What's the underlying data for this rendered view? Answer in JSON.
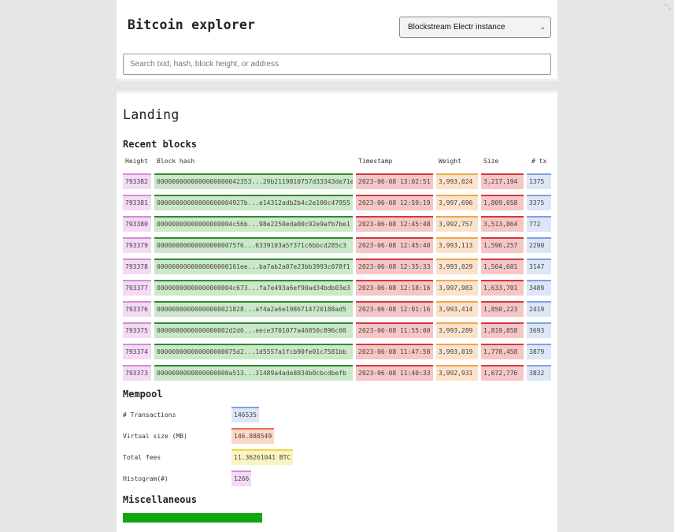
{
  "app": {
    "title": "Bitcoin explorer",
    "instance_selected": "Blockstream Electr instance",
    "search_placeholder": "Search txid, hash, block height, or address"
  },
  "page": {
    "title": "Landing"
  },
  "recent_blocks": {
    "title": "Recent blocks",
    "columns": [
      "Height",
      "Block hash",
      "Timestamp",
      "Weight",
      "Size",
      "# tx"
    ],
    "rows": [
      {
        "height": "793382",
        "hash": "0000000000000000000042353...29b2119810757d33343de71e",
        "timestamp": "2023-06-08 13:02:51",
        "weight": "3,993,024",
        "size": "3,217,194",
        "tx": "1375"
      },
      {
        "height": "793381",
        "hash": "00000000000000000004927b...e14312adb2b4c2e100c47955",
        "timestamp": "2023-06-08 12:59:19",
        "weight": "3,997,696",
        "size": "1,809,058",
        "tx": "3375"
      },
      {
        "height": "793380",
        "hash": "00000000000000000004c56b...98e2250eda00c92e9afb7be1",
        "timestamp": "2023-06-08 12:45:48",
        "weight": "3,992,757",
        "size": "3,513,864",
        "tx": "772"
      },
      {
        "height": "793379",
        "hash": "00000000000000000007576...6339103a5f371c6bbcd285c3",
        "timestamp": "2023-06-08 12:45:40",
        "weight": "3,993,113",
        "size": "1,596,257",
        "tx": "2290"
      },
      {
        "height": "793378",
        "hash": "0000000000000000000161ee...ba7ab2a07e23bb3993c078f1",
        "timestamp": "2023-06-08 12:35:33",
        "weight": "3,993,029",
        "size": "1,564,601",
        "tx": "3147"
      },
      {
        "height": "793377",
        "hash": "00000000000000000004c673...fa7e493a6ef90ad34bdb03e3",
        "timestamp": "2023-06-08 12:18:16",
        "weight": "3,997,983",
        "size": "1,633,701",
        "tx": "3489"
      },
      {
        "height": "793376",
        "hash": "00000000000000000021828...af4a2a6e1986714720188ad5",
        "timestamp": "2023-06-08 12:01:16",
        "weight": "3,993,414",
        "size": "1,850,223",
        "tx": "2419"
      },
      {
        "height": "793375",
        "hash": "0000000000000000002d2d6...eece3701077a46050c896c00",
        "timestamp": "2023-06-08 11:55:00",
        "weight": "3,993,289",
        "size": "1,819,858",
        "tx": "3693"
      },
      {
        "height": "793374",
        "hash": "000000000000000000075d2...1d5557a1fcb90fe01c7581bb",
        "timestamp": "2023-06-08 11:47:58",
        "weight": "3,993,019",
        "size": "1,778,458",
        "tx": "3879"
      },
      {
        "height": "793373",
        "hash": "0000000000000000000a513...31489a4ade8034b0cbcdbefb",
        "timestamp": "2023-06-08 11:40:33",
        "weight": "3,992,931",
        "size": "1,672,776",
        "tx": "3832"
      }
    ]
  },
  "mempool": {
    "title": "Mempool",
    "items": [
      {
        "label": "# Transactions",
        "value": "146535"
      },
      {
        "label": "Virtual size (MB)",
        "value": "146.888549"
      },
      {
        "label": "Total fees",
        "value": "11.36261041 BTC"
      },
      {
        "label": "Histogram(#)",
        "value": "1266"
      }
    ]
  },
  "misc": {
    "title": "Miscellaneous"
  }
}
